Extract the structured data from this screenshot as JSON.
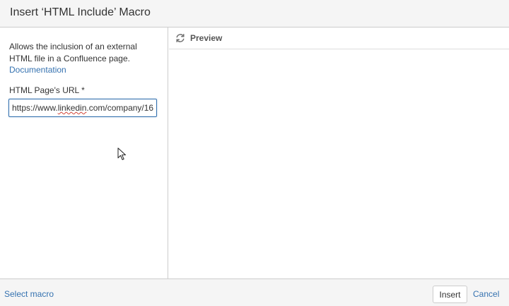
{
  "dialog": {
    "title": "Insert ‘HTML Include’ Macro"
  },
  "left_panel": {
    "description": "Allows the inclusion of an external HTML file in a Confluence page.",
    "documentation_link": "Documentation",
    "url_field": {
      "label": "HTML Page's URL *",
      "value_before_caret": "https://www.linkedin.com/company/16",
      "spellcheck_word": "linkedin"
    }
  },
  "preview": {
    "label": "Preview",
    "icon": "refresh-icon"
  },
  "footer": {
    "select_macro_link": "Select macro",
    "insert_button": "Insert",
    "cancel_link": "Cancel"
  },
  "colors": {
    "link": "#3572b0",
    "border": "#cccccc",
    "header_bg": "#f5f5f5",
    "text": "#333333"
  }
}
